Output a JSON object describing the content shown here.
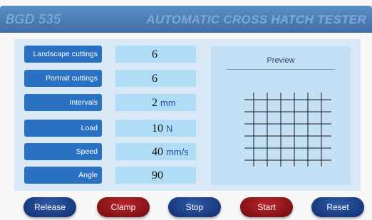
{
  "header": {
    "model": "BGD 535",
    "title": "AUTOMATIC CROSS HATCH TESTER"
  },
  "params": [
    {
      "label": "Landscape cuttings",
      "value": "6",
      "unit": ""
    },
    {
      "label": "Portrait cuttings",
      "value": "6",
      "unit": ""
    },
    {
      "label": "Intervals",
      "value": "2",
      "unit": "mm"
    },
    {
      "label": "Load",
      "value": "10",
      "unit": "N"
    },
    {
      "label": "Speed",
      "value": "40",
      "unit": "mm/s"
    },
    {
      "label": "Angle",
      "value": "90",
      "unit": ""
    }
  ],
  "preview": {
    "title": "Preview"
  },
  "buttons": {
    "release": "Release",
    "clamp": "Clamp",
    "stop": "Stop",
    "start": "Start",
    "reset": "Reset"
  },
  "colors": {
    "header": "#4a7db6",
    "label_bg": "#2a71c1",
    "value_bg": "#b0dcf5",
    "panel_bg": "#d8e8f7",
    "button_blue": "#1a3f86",
    "button_red": "#8e1418"
  }
}
